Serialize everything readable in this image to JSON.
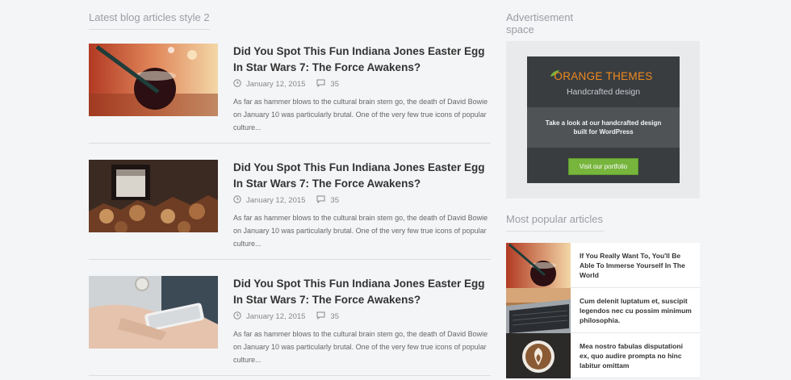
{
  "blog": {
    "section_title": "Latest blog articles style 2",
    "articles": [
      {
        "title": "Did You Spot This Fun Indiana Jones Easter Egg In Star Wars 7: The Force Awakens?",
        "date": "January 12, 2015",
        "comments": "35",
        "excerpt": "As far as hammer blows to the cultural brain stem go, the death of David Bowie on January 10 was particularly brutal. One of the very few true icons of popular culture...",
        "image": "glass-with-straw-photo"
      },
      {
        "title": "Did You Spot This Fun Indiana Jones Easter Egg In Star Wars 7: The Force Awakens?",
        "date": "January 12, 2015",
        "comments": "35",
        "excerpt": "As far as hammer blows to the cultural brain stem go, the death of David Bowie on January 10 was particularly brutal. One of the very few true icons of popular culture...",
        "image": "firewood-stack-photo"
      },
      {
        "title": "Did You Spot This Fun Indiana Jones Easter Egg In Star Wars 7: The Force Awakens?",
        "date": "January 12, 2015",
        "comments": "35",
        "excerpt": "As far as hammer blows to the cultural brain stem go, the death of David Bowie on January 10 was particularly brutal. One of the very few true icons of popular culture...",
        "image": "hand-with-phone-photo"
      }
    ]
  },
  "ad": {
    "section_title": "Advertisement space",
    "brand": "ORANGE THEMES",
    "tagline": "Handcrafted design",
    "promo": "Take a look at our handcrafted design built for WordPress",
    "cta": "Visit our portfolio"
  },
  "popular": {
    "section_title": "Most popular articles",
    "items": [
      {
        "title": "If You Really Want To, You'll Be Able To Immerse Yourself In The World",
        "image": "glass-with-straw-photo"
      },
      {
        "title": "Cum delenit luptatum et, suscipit legendos nec cu possim minimum philosophia.",
        "image": "laptop-keyboard-photo"
      },
      {
        "title": "Mea nostro fabulas disputationi ex, quo audire prompta no hinc labitur omittam",
        "image": "latte-art-photo"
      }
    ]
  },
  "colors": {
    "background": "#f4f5f7",
    "brand_orange": "#f08a1e",
    "cta_green": "#77b53d"
  }
}
